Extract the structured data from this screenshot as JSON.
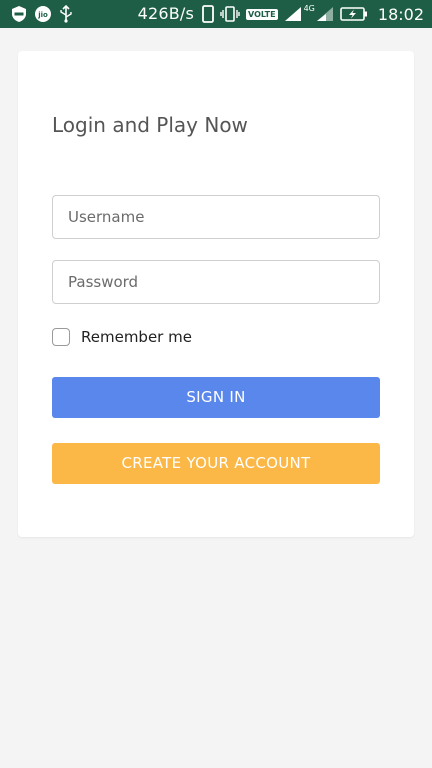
{
  "status_bar": {
    "speed": "426B/s",
    "volte": "VOLTE",
    "network": "4G",
    "sim1": "1",
    "sim2": "2",
    "time": "18:02"
  },
  "login": {
    "title": "Login and Play Now",
    "username_placeholder": "Username",
    "password_placeholder": "Password",
    "remember_label": "Remember me",
    "signin_label": "SIGN IN",
    "create_label": "CREATE YOUR ACCOUNT"
  },
  "colors": {
    "status_bar_bg": "#1e5e46",
    "page_bg": "#f4f4f4",
    "signin_bg": "#5a87ec",
    "create_bg": "#fcb847"
  }
}
